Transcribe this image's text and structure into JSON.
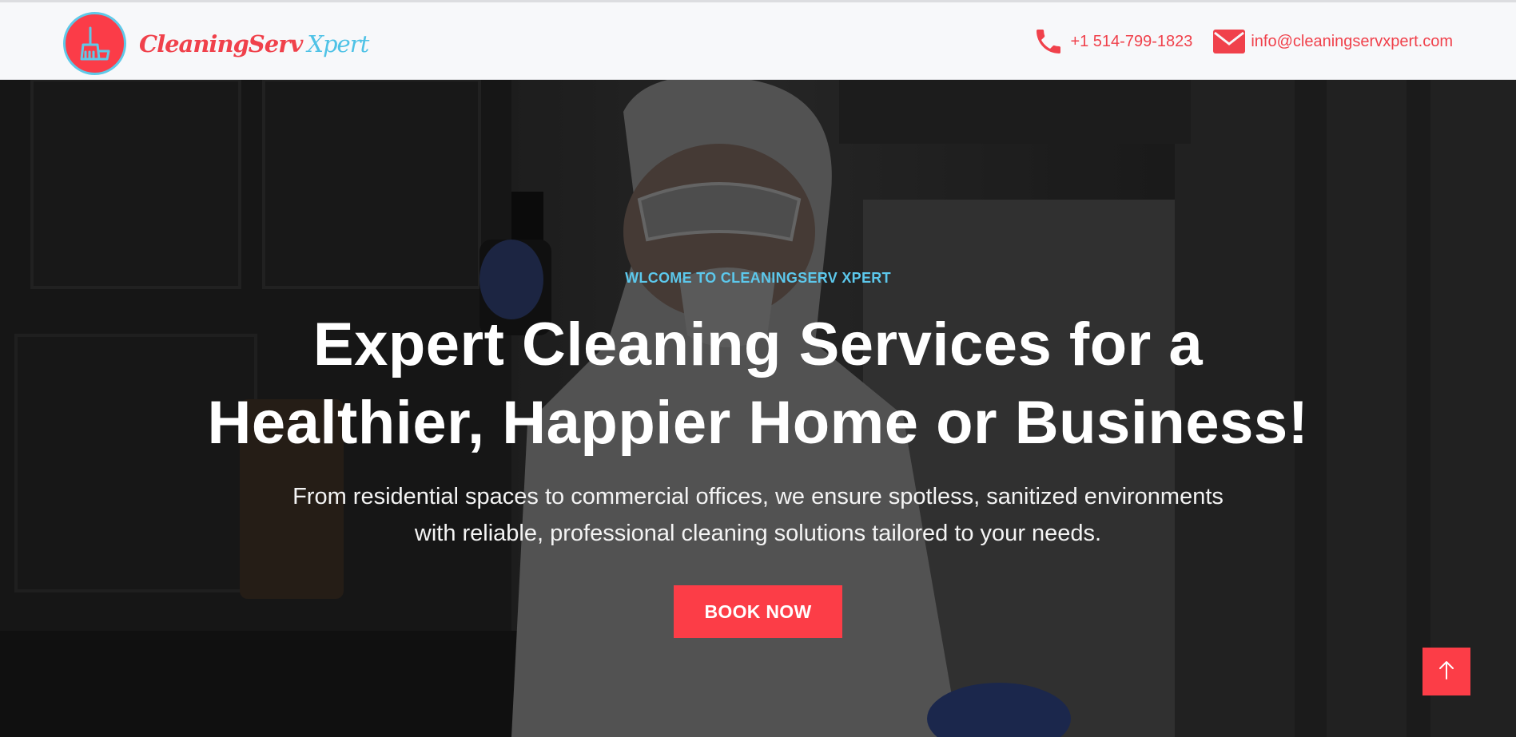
{
  "header": {
    "logo_word_1": "CleaningServ",
    "logo_word_2": "Xpert",
    "phone": "+1 514-799-1823",
    "email": "info@cleaningservxpert.com",
    "phone_icon": "phone-icon",
    "email_icon": "envelope-icon"
  },
  "hero": {
    "kicker": "WLCOME TO CLEANINGSERV XPERT",
    "headline_line_1": "Expert Cleaning Services for a",
    "headline_line_2": "Healthier, Happier Home or Business!",
    "sub_line_1": "From residential spaces to commercial offices, we ensure spotless, sanitized environments",
    "sub_line_2": "with reliable, professional cleaning solutions tailored to your needs.",
    "cta_label": "BOOK NOW",
    "scroll_top_icon": "arrow-up-icon"
  },
  "colors": {
    "brand_red": "#fc3d47",
    "brand_cyan": "#5cc8ec",
    "header_bg": "#f7f8fa"
  }
}
